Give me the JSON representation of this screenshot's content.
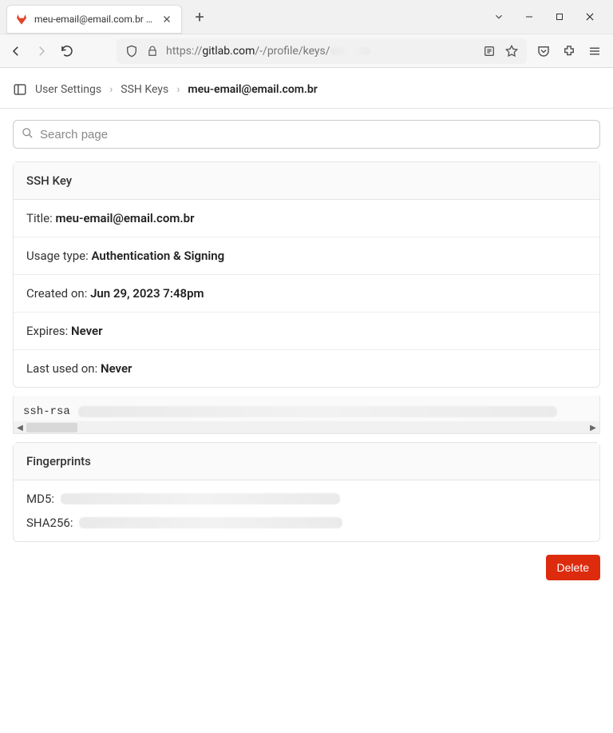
{
  "browser": {
    "tab_title": "meu-email@email.com.br · SSH",
    "url_prefix": "https://",
    "url_domain": "gitlab.com",
    "url_path": "/-/profile/keys/"
  },
  "breadcrumbs": {
    "items": [
      "User Settings",
      "SSH Keys",
      "meu-email@email.com.br"
    ]
  },
  "search": {
    "placeholder": "Search page"
  },
  "panel": {
    "header": "SSH Key",
    "title_label": "Title: ",
    "title_value": "meu-email@email.com.br",
    "usage_label": "Usage type: ",
    "usage_value": "Authentication & Signing",
    "created_label": "Created on: ",
    "created_value": "Jun 29, 2023 7:48pm",
    "expires_label": "Expires: ",
    "expires_value": "Never",
    "lastused_label": "Last used on: ",
    "lastused_value": "Never",
    "key_prefix": "ssh-rsa"
  },
  "fingerprints": {
    "header": "Fingerprints",
    "md5_label": "MD5:",
    "sha256_label": "SHA256:"
  },
  "actions": {
    "delete_label": "Delete"
  }
}
